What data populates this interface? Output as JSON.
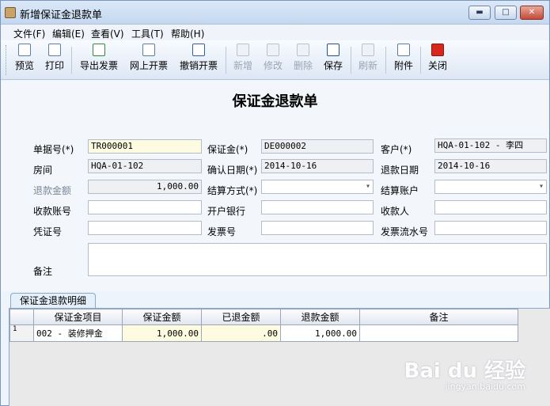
{
  "window": {
    "title": "新增保证金退款单",
    "controls": {
      "minimize": "▬",
      "maximize": "□",
      "close": "✕"
    }
  },
  "menu": [
    "文件(F)",
    "编辑(E)",
    "查看(V)",
    "工具(T)",
    "帮助(H)"
  ],
  "toolbar": [
    {
      "label": "预览",
      "icon": "preview-icon",
      "enabled": true
    },
    {
      "label": "打印",
      "icon": "printer-icon",
      "enabled": true
    },
    {
      "label": "导出发票",
      "icon": "export-invoice-icon",
      "enabled": true
    },
    {
      "label": "网上开票",
      "icon": "online-invoice-icon",
      "enabled": true
    },
    {
      "label": "撤销开票",
      "icon": "undo-icon",
      "enabled": true
    },
    {
      "label": "新增",
      "icon": "new-document-icon",
      "enabled": false
    },
    {
      "label": "修改",
      "icon": "edit-icon",
      "enabled": false
    },
    {
      "label": "删除",
      "icon": "delete-icon",
      "enabled": false
    },
    {
      "label": "保存",
      "icon": "save-icon",
      "enabled": true
    },
    {
      "label": "刷新",
      "icon": "refresh-icon",
      "enabled": false
    },
    {
      "label": "附件",
      "icon": "attachment-icon",
      "enabled": true
    },
    {
      "label": "关闭",
      "icon": "power-icon",
      "enabled": true
    }
  ],
  "form": {
    "title": "保证金退款单",
    "fields": {
      "doc_no": {
        "label": "单据号(*)",
        "value": "TR000001"
      },
      "deposit": {
        "label": "保证金(*)",
        "value": "DE000002"
      },
      "customer": {
        "label": "客户(*)",
        "value": "HQA-01-102 - 李四"
      },
      "room": {
        "label": "房间",
        "value": "HQA-01-102"
      },
      "confirm_date": {
        "label": "确认日期(*)",
        "value": "2014-10-16"
      },
      "refund_date": {
        "label": "退款日期",
        "value": "2014-10-16"
      },
      "refund_amount": {
        "label": "退款金额",
        "value": "1,000.00"
      },
      "settle_method": {
        "label": "结算方式(*)",
        "value": ""
      },
      "settle_account": {
        "label": "结算账户",
        "value": ""
      },
      "payee_account": {
        "label": "收款账号",
        "value": ""
      },
      "bank": {
        "label": "开户银行",
        "value": ""
      },
      "payee": {
        "label": "收款人",
        "value": ""
      },
      "voucher_no": {
        "label": "凭证号",
        "value": ""
      },
      "invoice_no": {
        "label": "发票号",
        "value": ""
      },
      "invoice_serial": {
        "label": "发票流水号",
        "value": ""
      },
      "remark": {
        "label": "备注",
        "value": ""
      }
    }
  },
  "detail": {
    "tab": "保证金退款明细",
    "columns": [
      "保证金项目",
      "保证金额",
      "已退金额",
      "退款金额",
      "备注"
    ],
    "rows": [
      {
        "no": "1",
        "item": "002 - 装修押金",
        "deposit_amount": "1,000.00",
        "refunded": ".00",
        "refund_amount": "1,000.00",
        "remark": ""
      }
    ]
  },
  "watermark": {
    "brand": "Bai du 经验",
    "url": "jingyan.baidu.com"
  }
}
